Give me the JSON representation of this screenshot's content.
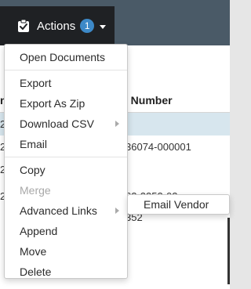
{
  "toolbar": {
    "actions_label": "Actions",
    "badge_count": "1",
    "icon": "clipboard-check-icon"
  },
  "table": {
    "header_left": "ne",
    "header_right": "e Number",
    "rows": [
      {
        "left": "2",
        "right": ""
      },
      {
        "left": "2",
        "right": "36074-000001"
      },
      {
        "left": "2",
        "right": ""
      },
      {
        "left": "2",
        "right": "62-2352-02"
      },
      {
        "left": "",
        "right": "352"
      }
    ]
  },
  "menu": {
    "items": [
      {
        "label": "Open Documents"
      },
      {
        "label": "Export"
      },
      {
        "label": "Export As Zip"
      },
      {
        "label": "Download CSV"
      },
      {
        "label": "Email"
      },
      {
        "label": "Copy"
      },
      {
        "label": "Merge",
        "disabled": true
      },
      {
        "label": "Advanced Links"
      },
      {
        "label": "Append"
      },
      {
        "label": "Move"
      },
      {
        "label": "Delete"
      }
    ]
  },
  "submenu": {
    "items": [
      {
        "label": "Email Vendor"
      }
    ]
  },
  "colors": {
    "topbar": "#4a5a67",
    "actions_button": "#1f2124",
    "badge": "#3d89c8",
    "selected_row": "#d7e6ee",
    "disabled_text": "#a8a8a8"
  }
}
